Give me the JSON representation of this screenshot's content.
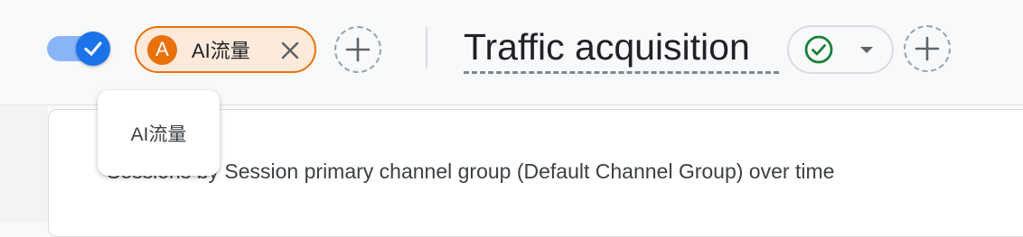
{
  "segment_chip": {
    "avatar_letter": "A",
    "label": "AI流量"
  },
  "report": {
    "title": "Traffic acquisition"
  },
  "card": {
    "title": "Sessions by Session primary channel group (Default Channel Group) over time"
  },
  "tooltip": {
    "text": "AI流量"
  },
  "colors": {
    "toggle_active": "#1a73e8",
    "chip_accent": "#e8710a",
    "chip_background": "#fdeadb",
    "status_ok": "#188038"
  },
  "icons": [
    "checkmark-icon",
    "close-icon",
    "add-icon",
    "check-circle-icon",
    "caret-down-icon"
  ]
}
